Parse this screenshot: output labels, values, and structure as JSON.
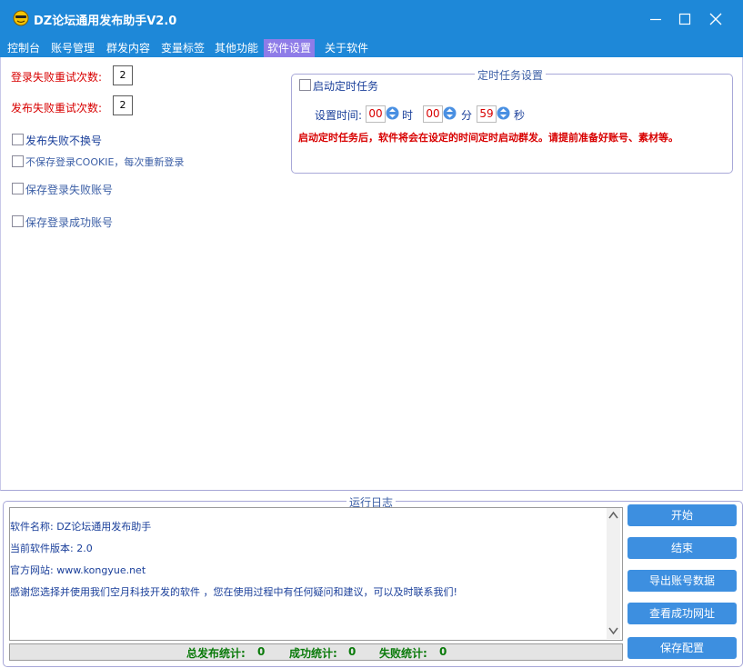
{
  "window": {
    "title": "DZ论坛通用发布助手V2.0"
  },
  "tabs": [
    {
      "label": "控制台"
    },
    {
      "label": "账号管理"
    },
    {
      "label": "群发内容"
    },
    {
      "label": "变量标签"
    },
    {
      "label": "其他功能"
    },
    {
      "label": "软件设置",
      "active": true
    },
    {
      "label": "关于软件"
    }
  ],
  "settings": {
    "login_retry_label": "登录失败重试次数:",
    "login_retry_value": "2",
    "publish_retry_label": "发布失败重试次数:",
    "publish_retry_value": "2",
    "options": [
      {
        "label": "发布失败不换号",
        "checked": false
      },
      {
        "label": "不保存登录COOKIE，每次重新登录",
        "checked": false
      },
      {
        "label": "保存登录失败账号",
        "checked": false
      },
      {
        "label": "保存登录成功账号",
        "checked": false
      }
    ]
  },
  "timer": {
    "group_title": "定时任务设置",
    "enable_label": "启动定时任务",
    "enabled": false,
    "time_label": "设置时间:",
    "hour": "00",
    "hour_unit": "时",
    "minute": "00",
    "minute_unit": "分",
    "second": "59",
    "second_unit": "秒",
    "note": "启动定时任务后，软件将会在设定的时间定时启动群发。请提前准备好账号、素材等。"
  },
  "log": {
    "group_title": "运行日志",
    "lines": [
      "软件名称: DZ论坛通用发布助手",
      "当前软件版本: 2.0",
      "官方网站: www.kongyue.net",
      "感谢您选择并使用我们空月科技开发的软件 ，您在使用过程中有任何疑问和建议，可以及时联系我们!"
    ]
  },
  "status": {
    "total_label": "总发布统计:",
    "total_value": "0",
    "success_label": "成功统计:",
    "success_value": "0",
    "fail_label": "失败统计:",
    "fail_value": "0"
  },
  "buttons": {
    "start": "开始",
    "stop": "结束",
    "export": "导出账号数据",
    "view_success": "查看成功网址",
    "save_config": "保存配置"
  },
  "colors": {
    "titlebar": "#1e88d8",
    "active_tab": "#8e7ce8",
    "button": "#3d8fe0",
    "error_red": "#d80000",
    "status_green": "#0a7a0a"
  }
}
